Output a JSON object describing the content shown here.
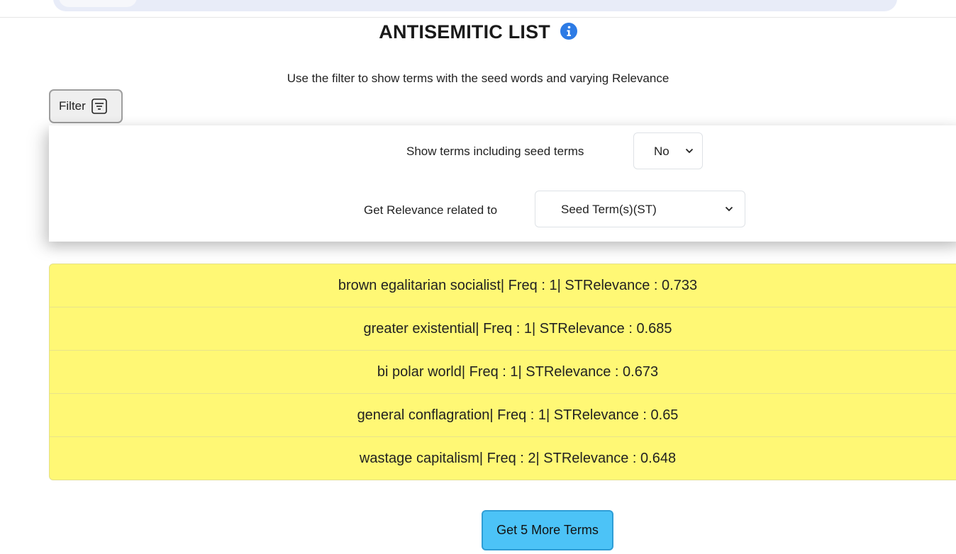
{
  "header": {
    "title": "ANTISEMITIC LIST",
    "subtitle": "Use the filter to show terms with the seed words and varying Relevance"
  },
  "filter": {
    "button_label": "Filter",
    "seed_terms_label": "Show terms including seed terms",
    "seed_terms_value": "No",
    "relevance_label": "Get Relevance related to",
    "relevance_value": "Seed Term(s)(ST)"
  },
  "terms": [
    {
      "text": "brown egalitarian socialist| Freq : 1| STRelevance : 0.733"
    },
    {
      "text": "greater existential| Freq : 1| STRelevance : 0.685"
    },
    {
      "text": "bi polar world| Freq : 1| STRelevance : 0.673"
    },
    {
      "text": "general conflagration| Freq : 1| STRelevance : 0.65"
    },
    {
      "text": "wastage capitalism| Freq : 2| STRelevance : 0.648"
    }
  ],
  "more_button_label": "Get 5 More Terms",
  "colors": {
    "terms_bg": "#fff875",
    "more_button_bg": "#4cc3f7",
    "info_icon": "#2d7be5"
  }
}
